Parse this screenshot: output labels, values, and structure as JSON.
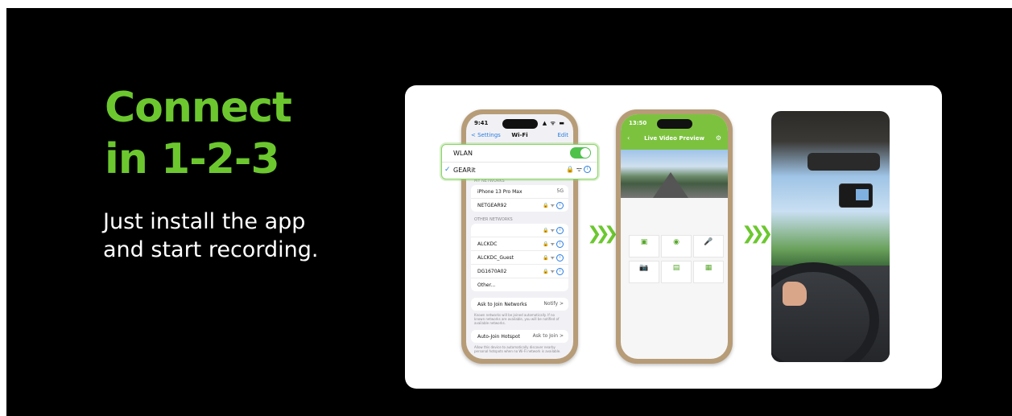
{
  "hero": {
    "headline_line1": "Connect",
    "headline_line2": "in 1-2-3",
    "sub_line1": "Just install the app",
    "sub_line2": "and start recording."
  },
  "colors": {
    "accent": "#6cc72f",
    "background": "#000000",
    "ios_blue": "#2a7de1",
    "toggle_on": "#4ec24b"
  },
  "phone1": {
    "status_time": "9:41",
    "status_icons": "▲ ᯤ ▬",
    "nav_back": "< Settings",
    "nav_title": "Wi-Fi",
    "nav_edit": "Edit",
    "zoom": {
      "wlan_label": "WLAN",
      "wlan_toggle": "on",
      "connected_label": "GEARit",
      "connected_icons": "🔒 ᯤ"
    },
    "my_networks_label": "MY NETWORKS",
    "my_networks": [
      {
        "name": "iPhone 13 Pro Max",
        "meta": "5G"
      },
      {
        "name": "NETGEAR92",
        "meta": "🔒 ᯤ"
      }
    ],
    "other_networks_label": "OTHER NETWORKS",
    "other_networks": [
      {
        "name": "",
        "meta": "🔒 ᯤ"
      },
      {
        "name": "ALCKDC",
        "meta": "🔒 ᯤ"
      },
      {
        "name": "ALCKDC_Guest",
        "meta": "🔒 ᯤ"
      },
      {
        "name": "DG1670A02",
        "meta": "🔒 ᯤ"
      },
      {
        "name": "Other...",
        "meta": ""
      }
    ],
    "ask_join_label": "Ask to Join Networks",
    "ask_join_value": "Notify >",
    "ask_join_note": "Known networks will be joined automatically. If no known networks are available, you will be notified of available networks.",
    "hotspot_label": "Auto-Join Hotspot",
    "hotspot_value": "Ask to Join >",
    "hotspot_note": "Allow this device to automatically discover nearby personal hotspots when no Wi-Fi network is available."
  },
  "chevrons": "❯❯❯",
  "phone2": {
    "status_time": "13:50",
    "title": "Live Video Preview",
    "tiles": [
      {
        "icon": "▣",
        "label": ""
      },
      {
        "icon": "◉",
        "label": ""
      },
      {
        "icon": "🎤",
        "label": ""
      },
      {
        "icon": "📷",
        "label": ""
      },
      {
        "icon": "▤",
        "label": ""
      },
      {
        "icon": "▦",
        "label": ""
      }
    ]
  }
}
